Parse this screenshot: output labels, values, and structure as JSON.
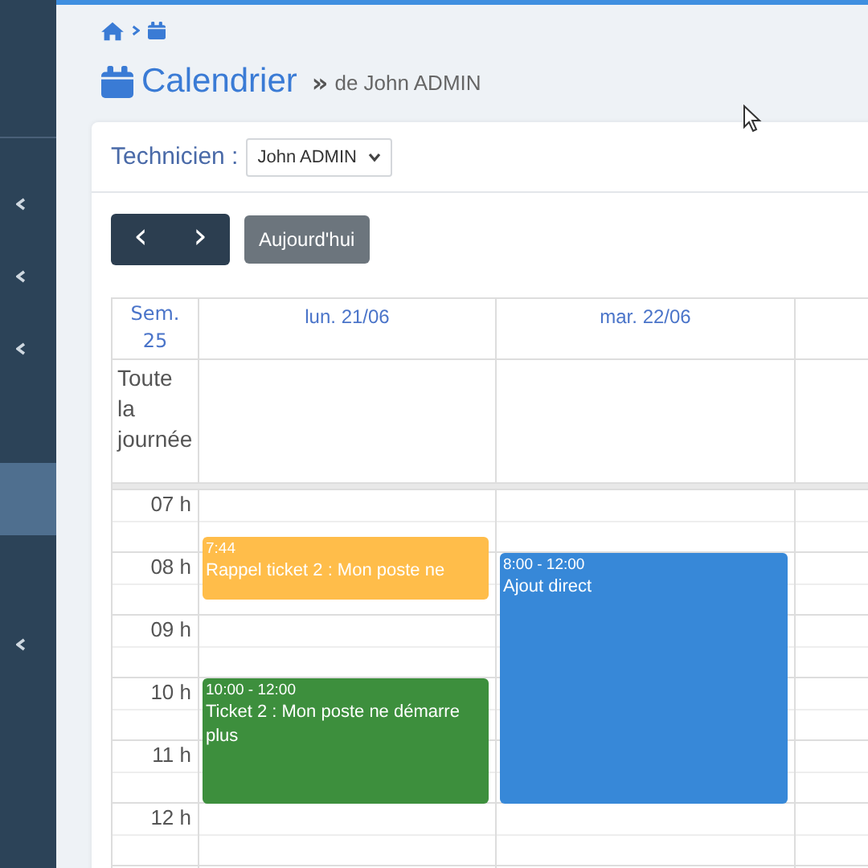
{
  "sidebar": {
    "items": [
      {
        "selected": false,
        "expandable": true
      },
      {
        "selected": false,
        "expandable": true
      },
      {
        "selected": false,
        "expandable": true
      },
      {
        "selected": true,
        "expandable": false
      },
      {
        "selected": false,
        "expandable": true
      }
    ]
  },
  "breadcrumb": [
    {
      "kind": "home"
    },
    {
      "kind": "calendar"
    }
  ],
  "title": {
    "text": "Calendrier",
    "separator": "»",
    "subtitle": "de John ADMIN"
  },
  "filter": {
    "label": "Technicien :",
    "value": "John ADMIN"
  },
  "toolbar": {
    "prev": "‹",
    "next": "›",
    "today": "Aujourd'hui"
  },
  "calendar": {
    "week": "Sem. 25",
    "all_day": "Toute la journée",
    "hours": [
      "07 h",
      "08 h",
      "09 h",
      "10 h",
      "11 h",
      "12 h"
    ],
    "days": [
      {
        "label": "lun. 21/06",
        "events": [
          {
            "time": "7:44",
            "title": "Rappel ticket 2 : Mon poste ne",
            "color": "#ffbd4a"
          },
          {
            "time": "10:00 - 12:00",
            "title": "Ticket 2 : Mon poste ne démarre plus",
            "color": "#3d8f3d"
          }
        ]
      },
      {
        "label": "mar. 22/06",
        "events": [
          {
            "time": "8:00 - 12:00",
            "title": "Ajout direct",
            "color": "#3788d8"
          }
        ]
      }
    ]
  }
}
